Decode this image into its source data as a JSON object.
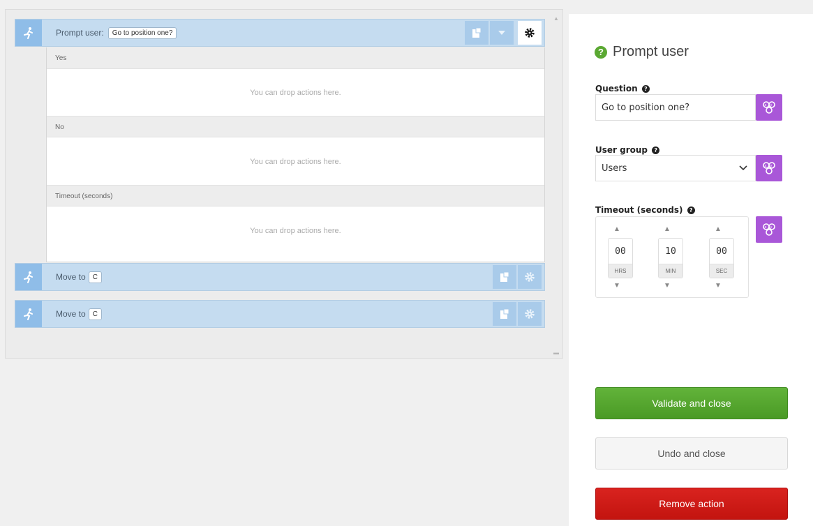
{
  "editor": {
    "prompt_action": {
      "label": "Prompt user:",
      "question_pill": "Go to position one?",
      "branches": [
        {
          "label": "Yes",
          "drop_hint": "You can drop actions here."
        },
        {
          "label": "No",
          "drop_hint": "You can drop actions here."
        },
        {
          "label": "Timeout (seconds)",
          "drop_hint": "You can drop actions here."
        }
      ]
    },
    "move_actions": [
      {
        "label": "Move to",
        "target": "C"
      },
      {
        "label": "Move to",
        "target": "C"
      }
    ]
  },
  "panel": {
    "title": "Prompt user",
    "question": {
      "label": "Question",
      "value": "Go to position one?"
    },
    "user_group": {
      "label": "User group",
      "selected": "Users"
    },
    "timeout": {
      "label": "Timeout (seconds)",
      "hours": "00",
      "minutes": "10",
      "seconds": "00",
      "hours_unit": "HRS",
      "minutes_unit": "MIN",
      "seconds_unit": "SEC"
    },
    "validate_label": "Validate and close",
    "undo_label": "Undo and close",
    "remove_label": "Remove action"
  },
  "icons": {
    "action": "running-person-icon",
    "paste": "paste-icon",
    "collapse": "chevron-down-icon",
    "settings": "gear-icon",
    "help": "question-icon",
    "variable": "variable-icon"
  },
  "colors": {
    "action_bar": "#c5dcf0",
    "validate": "#5aa832",
    "remove": "#cc1a16",
    "variable": "#a957d8"
  }
}
